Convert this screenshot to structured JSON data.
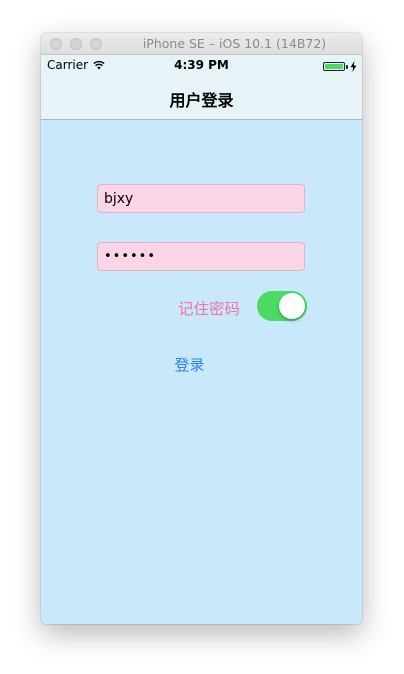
{
  "window": {
    "title": "iPhone SE – iOS 10.1 (14B72)"
  },
  "status_bar": {
    "carrier": "Carrier",
    "time": "4:39 PM",
    "wifi_icon": "wifi-icon",
    "battery_icon": "battery-icon",
    "charging_icon": "charging-bolt-icon"
  },
  "nav_bar": {
    "title": "用户登录"
  },
  "form": {
    "username_value": "bjxy",
    "password_value": "••••••",
    "remember_label": "记住密码",
    "remember_on": true,
    "login_label": "登录"
  },
  "colors": {
    "background": "#c9e8fb",
    "field_background": "#fad5e6",
    "remember_label": "#f075aa",
    "switch_on": "#4cd964",
    "login_link": "#2f7ff6"
  }
}
